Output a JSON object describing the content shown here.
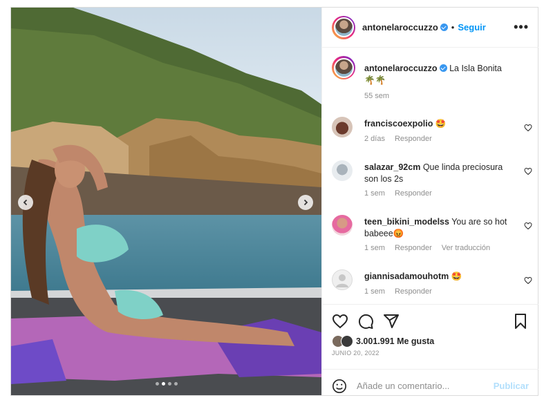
{
  "header": {
    "username": "antonelaroccuzzo",
    "separator": "•",
    "follow_label": "Seguir",
    "more_label": "•••"
  },
  "caption": {
    "username": "antonelaroccuzzo",
    "text": "La Isla Bonita🌴🌴",
    "time": "55 sem"
  },
  "comments": [
    {
      "username": "franciscoexpolio",
      "text": "🤩",
      "time": "2 días",
      "reply": "Responder"
    },
    {
      "username": "salazar_92cm",
      "text": "Que linda preciosura son los 2s",
      "time": "1 sem",
      "reply": "Responder"
    },
    {
      "username": "teen_bikini_modelss",
      "text": "You are so hot babeee😡",
      "time": "1 sem",
      "reply": "Responder",
      "translate": "Ver traducción"
    },
    {
      "username": "giannisadamouhotm",
      "text": "🤩",
      "time": "1 sem",
      "reply": "Responder"
    }
  ],
  "likes": {
    "count_text": "3.001.991 Me gusta"
  },
  "date": "JUNIO 20, 2022",
  "add_comment": {
    "placeholder": "Añade un comentario...",
    "post_label": "Publicar"
  },
  "carousel": {
    "slides": 4,
    "active": 1
  },
  "colors": {
    "accent": "#0095f6",
    "verified": "#3897f0",
    "meta": "#8e8e8e"
  }
}
